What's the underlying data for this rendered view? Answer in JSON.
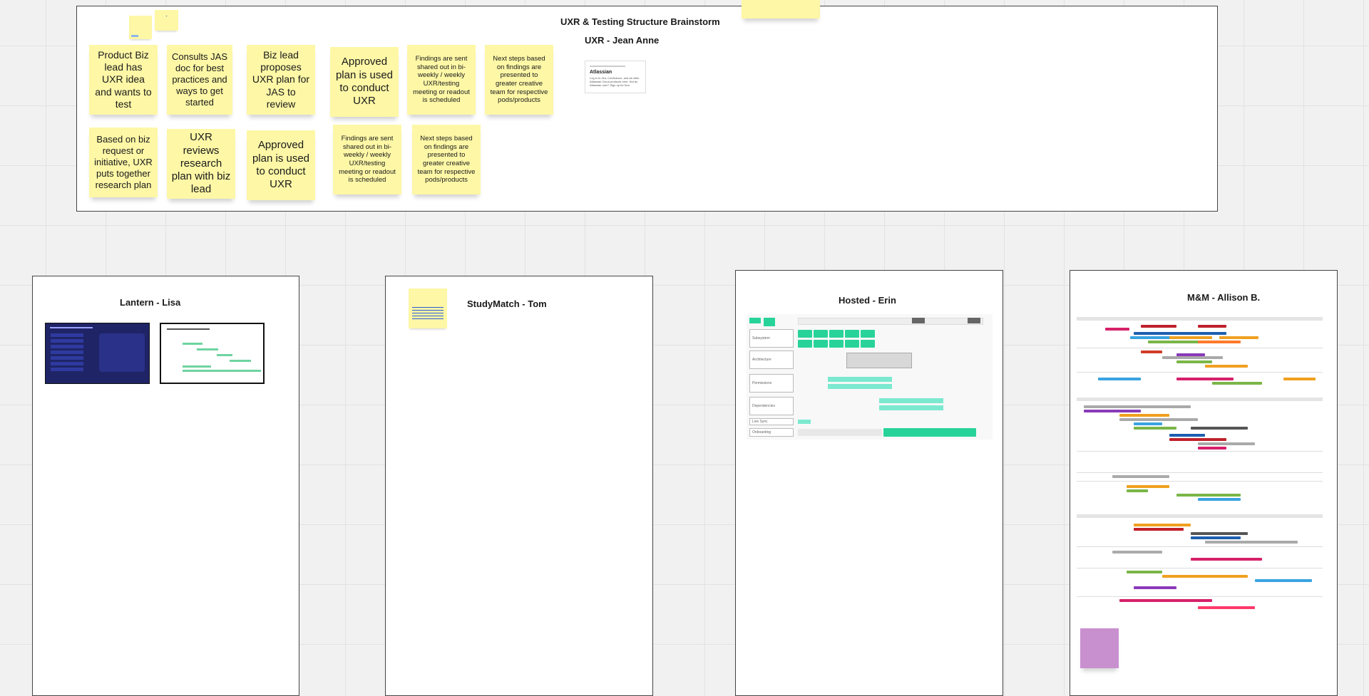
{
  "board": {
    "brainstorm_frame": {
      "title": "UXR & Testing Structure Brainstorm",
      "subtitle": "UXR - Jean Anne",
      "row1": [
        "Product Biz lead has UXR idea and wants to test",
        "Consults JAS doc for best practices and ways to get started",
        "Biz lead proposes UXR plan for JAS to review",
        "Approved plan is used to conduct UXR",
        "Findings are sent shared out in bi-weekly / weekly UXR/testing meeting or readout is scheduled",
        "Next steps based on findings are presented to greater creative team for respective pods/products"
      ],
      "row2": [
        "Based on biz request or initiative, UXR puts together research plan",
        "UXR reviews research plan with biz lead",
        "Approved plan is used to conduct UXR",
        "Findings are sent shared out in bi-weekly / weekly UXR/testing meeting or readout is scheduled",
        "Next steps based on findings are presented to greater creative team for respective pods/products"
      ],
      "atlassian_card": {
        "title": "Atlassian",
        "body": "Log in to Jira, Confluence, and all other Atlassian Cloud products here. Not an Atlassian user? Sign up for free."
      }
    },
    "lantern_frame": {
      "title": "Lantern - Lisa"
    },
    "studymatch_frame": {
      "title": "StudyMatch - Tom"
    },
    "hosted_frame": {
      "title": "Hosted - Erin",
      "rows": [
        "Subsystem",
        "Architecture",
        "Permissions",
        "Dependencies",
        "Live Sync",
        "Onboarding"
      ]
    },
    "mm_frame": {
      "title": "M&M - Allison B."
    }
  },
  "colors": {
    "sticky_yellow": "#fdf7a6",
    "sticky_purple": "#c990cf",
    "hosted_green": "#28d39a",
    "lantern_navy": "#1f2466"
  }
}
